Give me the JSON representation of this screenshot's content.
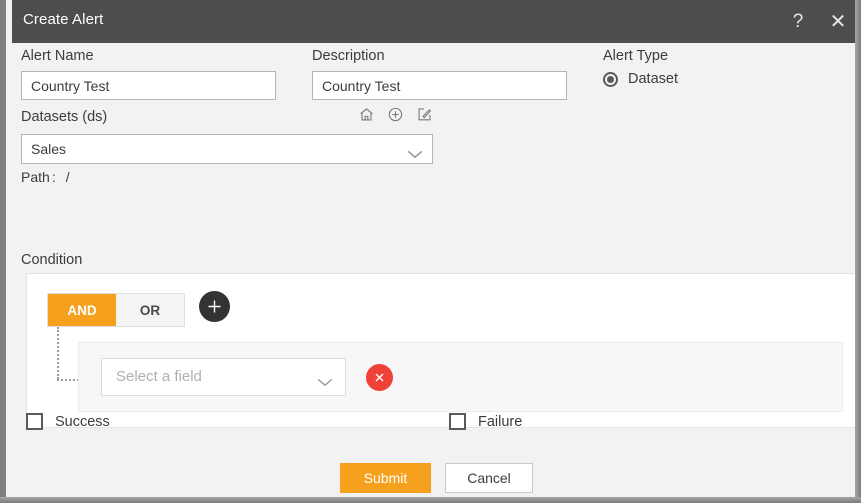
{
  "window": {
    "title": "Create Alert",
    "help_icon": "question-mark-icon",
    "close_icon": "close-icon"
  },
  "form": {
    "alert_name": {
      "label": "Alert Name",
      "value": "Country Test",
      "placeholder": ""
    },
    "description": {
      "label": "Description",
      "value": "Country Test",
      "placeholder": ""
    },
    "alert_type": {
      "label": "Alert Type",
      "options": [
        "Dataset"
      ],
      "selected": "Dataset"
    },
    "datasets": {
      "label": "Datasets (ds)",
      "selected": "Sales",
      "chevron_icon": "chevron-down-icon",
      "actions": [
        {
          "name": "home-icon",
          "title": "Home"
        },
        {
          "name": "plus-circle-icon",
          "title": "Add"
        },
        {
          "name": "edit-icon",
          "title": "Edit"
        }
      ],
      "path_label": "Path",
      "path_separator": ":",
      "path_value": "/"
    }
  },
  "condition": {
    "label": "Condition",
    "logic": {
      "options": [
        {
          "label": "AND",
          "active": true
        },
        {
          "label": "OR",
          "active": false
        }
      ]
    },
    "add_button_icon": "plus-icon",
    "rows": [
      {
        "field_placeholder": "Select a field",
        "chevron_icon": "chevron-down-icon",
        "remove_icon": "close-circle-icon"
      }
    ]
  },
  "status": {
    "success": {
      "label": "Success",
      "checked": false
    },
    "failure": {
      "label": "Failure",
      "checked": false
    }
  },
  "footer": {
    "submit_label": "Submit",
    "cancel_label": "Cancel"
  },
  "colors": {
    "accent_orange": "#f5a11d",
    "danger_red": "#ef4136",
    "titlebar": "#4d4d4d",
    "panel_background": "#f2f2f2",
    "add_button": "#333333"
  }
}
